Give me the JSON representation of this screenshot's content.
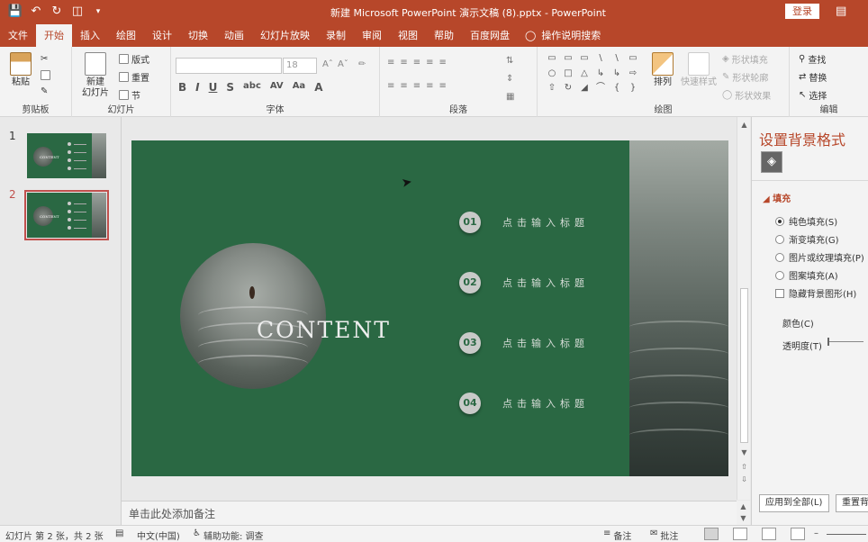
{
  "title": {
    "window": "新建 Microsoft PowerPoint 演示文稿 (8).pptx  -  PowerPoint",
    "login": "登录"
  },
  "tabs": [
    "文件",
    "开始",
    "插入",
    "绘图",
    "设计",
    "切换",
    "动画",
    "幻灯片放映",
    "录制",
    "审阅",
    "视图",
    "帮助",
    "百度网盘"
  ],
  "tabs_active_index": 1,
  "help": "操作说明搜索",
  "ribbon": {
    "clipboard": {
      "paste": "粘贴",
      "label": "剪贴板"
    },
    "slides": {
      "new_slide_line1": "新建",
      "new_slide_line2": "幻灯片",
      "layout": "版式",
      "reset": "重置",
      "section": "节",
      "label": "幻灯片"
    },
    "font": {
      "size": "18",
      "label": "字体"
    },
    "paragraph": {
      "label": "段落"
    },
    "drawing": {
      "arrange": "排列",
      "quick_styles": "快速样式",
      "shape_fill": "形状填充",
      "shape_outline": "形状轮廓",
      "shape_effects": "形状效果",
      "label": "绘图"
    },
    "editing": {
      "find": "查找",
      "replace": "替换",
      "select": "选择",
      "label": "编辑"
    }
  },
  "thumbnails": [
    {
      "num": "1",
      "text": "CONTENT"
    },
    {
      "num": "2",
      "text": "CONTENT"
    }
  ],
  "selected_slide": 2,
  "slide": {
    "title": "CONTENT",
    "items": [
      {
        "num": "01",
        "text": "点击输入标题"
      },
      {
        "num": "02",
        "text": "点击输入标题"
      },
      {
        "num": "03",
        "text": "点击输入标题"
      },
      {
        "num": "04",
        "text": "点击输入标题"
      }
    ],
    "bg_color": "#2a6843"
  },
  "notes_placeholder": "单击此处添加备注",
  "format_pane": {
    "title": "设置背景格式",
    "section": "填充",
    "options": [
      "纯色填充(S)",
      "渐变填充(G)",
      "图片或纹理填充(P)",
      "图案填充(A)"
    ],
    "selected_option": 0,
    "hide_bg": "隐藏背景图形(H)",
    "color_label": "颜色(C)",
    "transparency_label": "透明度(T)",
    "apply_all": "应用到全部(L)",
    "reset_bg": "重置背"
  },
  "status": {
    "slide_info": "幻灯片 第 2 张，共 2 张",
    "language": "中文(中国)",
    "accessibility": "辅助功能: 调查",
    "notes": "备注",
    "comments": "批注"
  },
  "accent_color": "#b7472a"
}
